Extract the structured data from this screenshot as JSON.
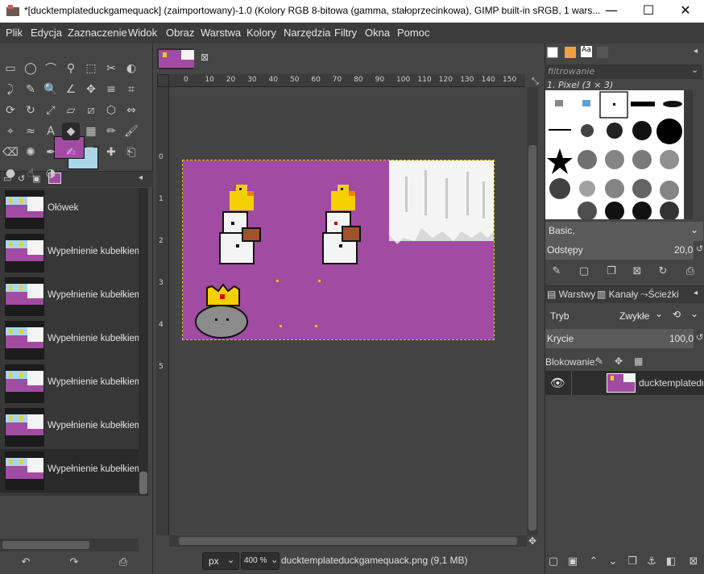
{
  "window": {
    "title": "*[ducktemplateduckgamequack] (zaimportowany)-1.0 (Kolory RGB 8-bitowa (gamma, stałoprzecinkowa), GIMP built-in sRGB, 1 wars...",
    "minimize": "—",
    "maximize": "☐",
    "close": "✕"
  },
  "menubar": [
    "Plik",
    "Edycja",
    "Zaznaczenie",
    "Widok",
    "Obraz",
    "Warstwa",
    "Kolory",
    "Narzędzia",
    "Filtry",
    "Okna",
    "Pomoc"
  ],
  "toolbox": {
    "icons": [
      "rect-select-icon",
      "ellipse-select-icon",
      "free-select-icon",
      "fuzzy-select-icon",
      "by-color-select-icon",
      "scissors-select-icon",
      "foreground-select-icon",
      "paths-icon",
      "color-picker-icon",
      "zoom-icon",
      "measure-icon",
      "move-icon",
      "align-icon",
      "crop-icon",
      "unified-transform-icon",
      "rotate-icon",
      "scale-icon",
      "shear-icon",
      "perspective-icon",
      "3d-transform-icon",
      "flip-icon",
      "cage-icon",
      "warp-icon",
      "text-icon",
      "bucket-fill-icon",
      "gradient-icon",
      "pencil-icon",
      "paintbrush-icon",
      "eraser-icon",
      "airbrush-icon",
      "ink-icon",
      "mypaint-icon",
      "clone-icon",
      "heal-icon",
      "perspective-clone-icon",
      "blur-icon",
      "smudge-icon",
      "dodge-burn-icon"
    ],
    "glyphs": [
      "▭",
      "◯",
      "⌒",
      "⚲",
      "⬚",
      "✂",
      "◐",
      "⤸",
      "✎",
      "🔍",
      "∠",
      "✥",
      "≡",
      "⌗",
      "⟳",
      "↻",
      "⤢",
      "▱",
      "⧄",
      "⬡",
      "⇔",
      "⌖",
      "≈",
      "A",
      "◆",
      "▦",
      "✏",
      "🖌",
      "⌫",
      "✺",
      "✒",
      "✍",
      "⎘",
      "✚",
      "⎗",
      "●",
      "☝",
      "◑"
    ],
    "active_tool_index": 24
  },
  "colors": {
    "foreground": "#a24ba3",
    "background": "#a8d8ea"
  },
  "history": {
    "items": [
      {
        "label": "Ołówek"
      },
      {
        "label": "Wypełnienie kubełkiem"
      },
      {
        "label": "Wypełnienie kubełkiem"
      },
      {
        "label": "Wypełnienie kubełkiem"
      },
      {
        "label": "Wypełnienie kubełkiem"
      },
      {
        "label": "Wypełnienie kubełkiem"
      },
      {
        "label": "Wypełnienie kubełkiem"
      }
    ],
    "selected_index": 6
  },
  "rulers": {
    "h": [
      "0",
      "10",
      "20",
      "30",
      "40",
      "50",
      "60",
      "70",
      "80",
      "90",
      "100",
      "110",
      "120",
      "130",
      "140",
      "150"
    ],
    "v": [
      "0",
      "1",
      "2",
      "3",
      "4",
      "5"
    ]
  },
  "status": {
    "unit": "px",
    "zoom": "400 %",
    "filename": "ducktemplateduckgamequack.png (9,1 MB)"
  },
  "brushes": {
    "filter_placeholder": "filtrowanie",
    "current": "1. Pixel (3 × 3)",
    "preset": "Basic,",
    "spacing_label": "Odstępy",
    "spacing_value": "20,0"
  },
  "layers": {
    "tabs": [
      "Warstwy",
      "Kanały",
      "Ścieżki"
    ],
    "mode_label": "Tryb",
    "mode_value": "Zwykłe",
    "opacity_label": "Krycie",
    "opacity_value": "100,0",
    "lock_label": "Blokowanie:",
    "layer_name": "ducktemplateduc"
  }
}
